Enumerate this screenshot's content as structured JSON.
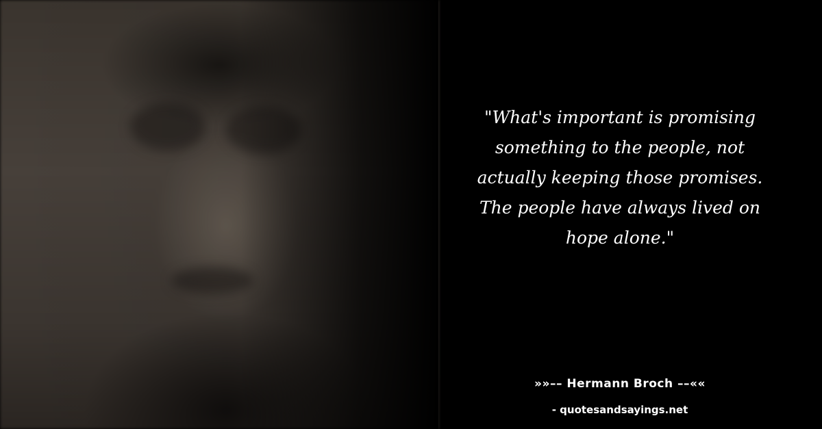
{
  "quote": {
    "lines": [
      "\"What's important is promising",
      "something to the people, not",
      "actually keeping those promises.",
      "The people have always lived on",
      "hope alone.\""
    ]
  },
  "author": {
    "label": "»»–– Hermann Broch ––««"
  },
  "source": {
    "label": "- quotesandsayings.net"
  },
  "colors": {
    "background": "#000000",
    "text": "#ffffff",
    "portrait_tone": "#47403a"
  },
  "image": {
    "subject": "blurred sepia portrait photo of a man"
  }
}
